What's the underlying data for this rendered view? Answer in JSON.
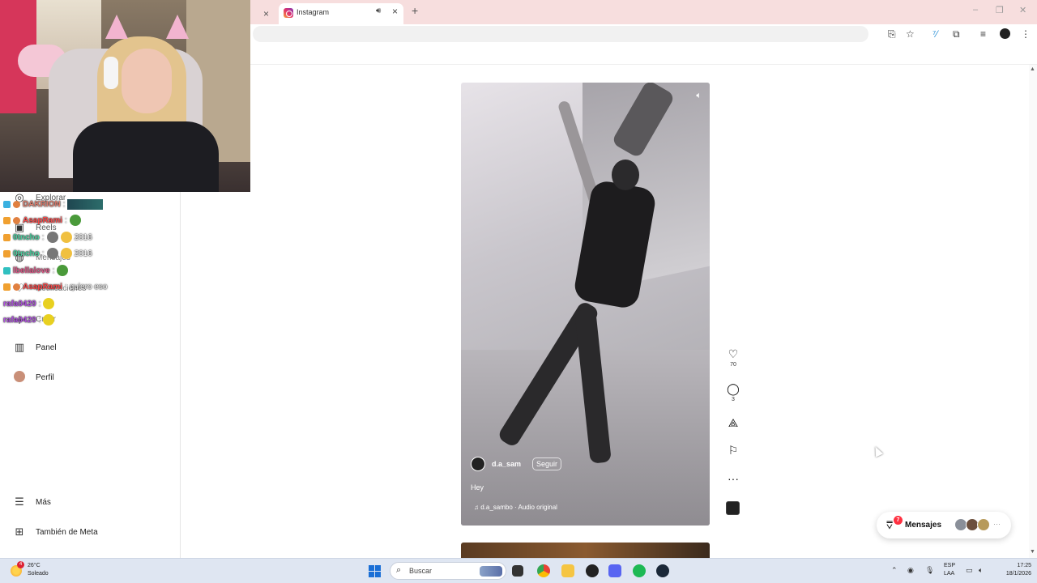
{
  "browser": {
    "prev_tab_close": "×",
    "active_tab": {
      "title": "Instagram",
      "audio_icon": "speaker-icon",
      "close": "×"
    },
    "new_tab": "+",
    "window_controls": [
      "–",
      "❐",
      "✕"
    ]
  },
  "sidebar": {
    "items": [
      {
        "label": "Explorar",
        "icon": "compass-icon"
      },
      {
        "label": "Reels",
        "icon": "reels-icon"
      },
      {
        "label": "Mensajes",
        "icon": "messenger-icon"
      },
      {
        "label": "Notificaciones",
        "icon": "heart-icon"
      },
      {
        "label": "Crear",
        "icon": "plus-icon"
      },
      {
        "label": "Panel",
        "icon": "chart-icon"
      },
      {
        "label": "Perfil",
        "icon": "avatar-icon"
      }
    ],
    "more": "Más",
    "meta": "También de Meta"
  },
  "chat": [
    {
      "user": "DAKRION",
      "color": "#e08070",
      "message": ""
    },
    {
      "user": "AsapRami",
      "color": "#ff4b4b",
      "message": ""
    },
    {
      "user": "0tncho",
      "color": "#4cd0a0",
      "message": "2016"
    },
    {
      "user": "0tncho",
      "color": "#4cd0a0",
      "message": "2016"
    },
    {
      "user": "lbellalove",
      "color": "#e05a8a",
      "message": ""
    },
    {
      "user": "AsapRami",
      "color": "#ff4b4b",
      "message": "quiero eso"
    },
    {
      "user": "rafa0420",
      "color": "#b052e0",
      "message": ""
    },
    {
      "user": "rafa0420",
      "color": "#b052e0",
      "message": ""
    }
  ],
  "reel": {
    "username": "d.a_sam",
    "follow_label": "Seguir",
    "caption": "Hey",
    "audio": "d.a_sambo · Audio original",
    "audio_icon": "music-note-icon"
  },
  "actions": {
    "likes": "70",
    "comments": "3",
    "more": "···"
  },
  "messages": {
    "label": "Mensajes",
    "badge": "7"
  },
  "taskbar": {
    "weather_temp": "26°C",
    "weather_cond": "Soleado",
    "weather_badge": "4",
    "search_placeholder": "Buscar",
    "lang_line1": "ESP",
    "lang_line2": "LAA",
    "time": "17:25",
    "date": "18/1/2026"
  }
}
